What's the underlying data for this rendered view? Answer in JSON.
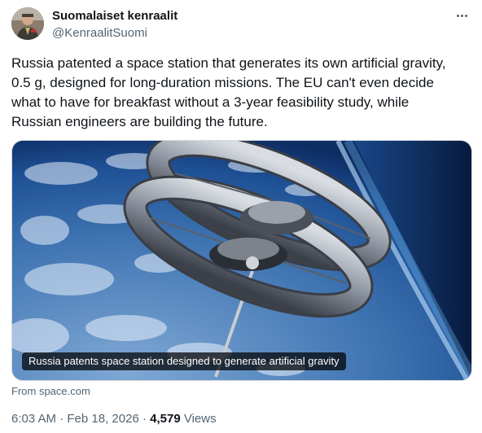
{
  "author": {
    "name": "Suomalaiset kenraalit",
    "handle": "@KenraalitSuomi"
  },
  "tweet": {
    "text": "Russia patented a space station that generates its own artificial gravity,\n0.5 g, designed for long-duration missions. The EU can't even decide\nwhat to have for breakfast without a 3-year feasibility study, while\nRussian engineers are building the future."
  },
  "media": {
    "caption": "Russia patents space station designed to generate artificial gravity"
  },
  "source": {
    "label": "From space.com"
  },
  "meta": {
    "time": "6:03 AM",
    "separator": "·",
    "date": "Feb 18, 2026",
    "views_count": "4,579",
    "views_label": "Views"
  },
  "icons": {
    "more": "more-dots-icon"
  }
}
